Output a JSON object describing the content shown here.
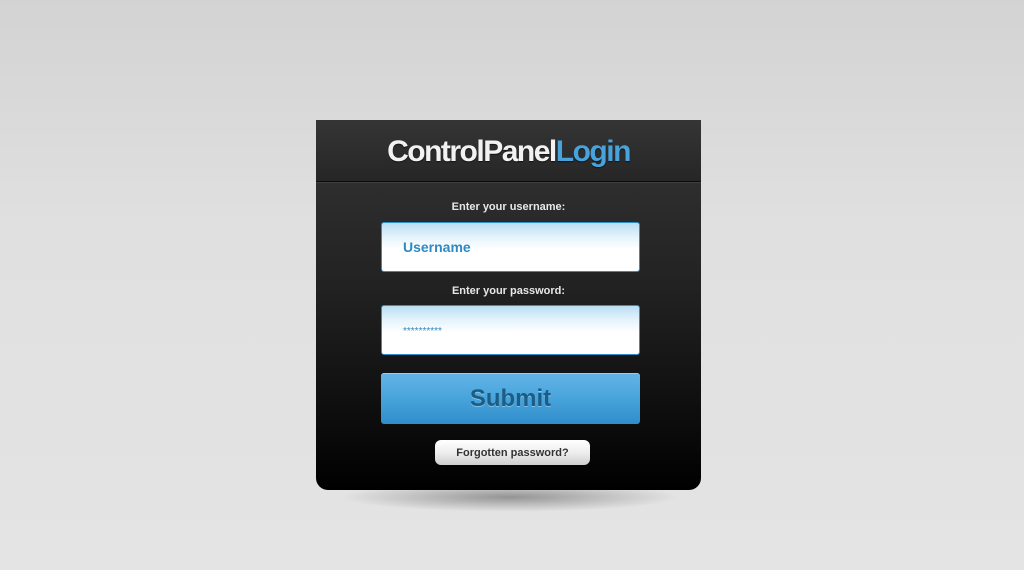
{
  "login": {
    "title_part1": "ControlPanel",
    "title_part2": "Login",
    "username_label": "Enter your username:",
    "username_value": "Username",
    "password_label": "Enter your password:",
    "password_mask": "**********",
    "submit_label": "Submit",
    "forgot_label": "Forgotten password?"
  },
  "colors": {
    "accent": "#48a2dc",
    "button_top": "#64b4e5",
    "button_bottom": "#2f8dca",
    "panel_dark": "#000000",
    "field_text": "#2d8ac2"
  }
}
